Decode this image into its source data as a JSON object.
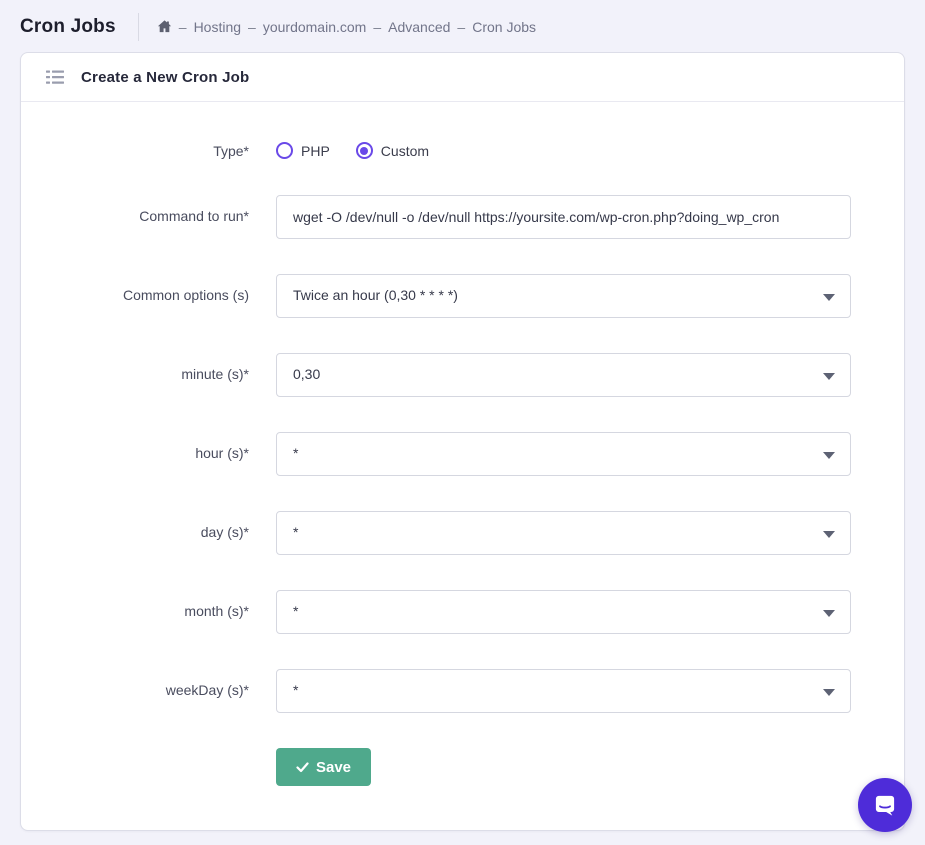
{
  "page": {
    "title": "Cron Jobs"
  },
  "breadcrumb": {
    "separator": "–",
    "items": [
      "Hosting",
      "yourdomain.com",
      "Advanced",
      "Cron Jobs"
    ]
  },
  "card": {
    "title": "Create a New Cron Job"
  },
  "form": {
    "type": {
      "label": "Type*",
      "options": [
        {
          "label": "PHP",
          "selected": false
        },
        {
          "label": "Custom",
          "selected": true
        }
      ]
    },
    "command": {
      "label": "Command to run*",
      "value": "wget -O /dev/null -o /dev/null https://yoursite.com/wp-cron.php?doing_wp_cron"
    },
    "common_options": {
      "label": "Common options (s)",
      "value": "Twice an hour (0,30 * * * *)"
    },
    "minute": {
      "label": "minute (s)*",
      "value": "0,30"
    },
    "hour": {
      "label": "hour (s)*",
      "value": "*"
    },
    "day": {
      "label": "day (s)*",
      "value": "*"
    },
    "month": {
      "label": "month (s)*",
      "value": "*"
    },
    "weekday": {
      "label": "weekDay (s)*",
      "value": "*"
    },
    "save_label": "Save"
  },
  "colors": {
    "accent_purple": "#673de6",
    "success_green": "#4fa98c",
    "chat_purple": "#4e2cd9",
    "background": "#f2f2fa"
  }
}
